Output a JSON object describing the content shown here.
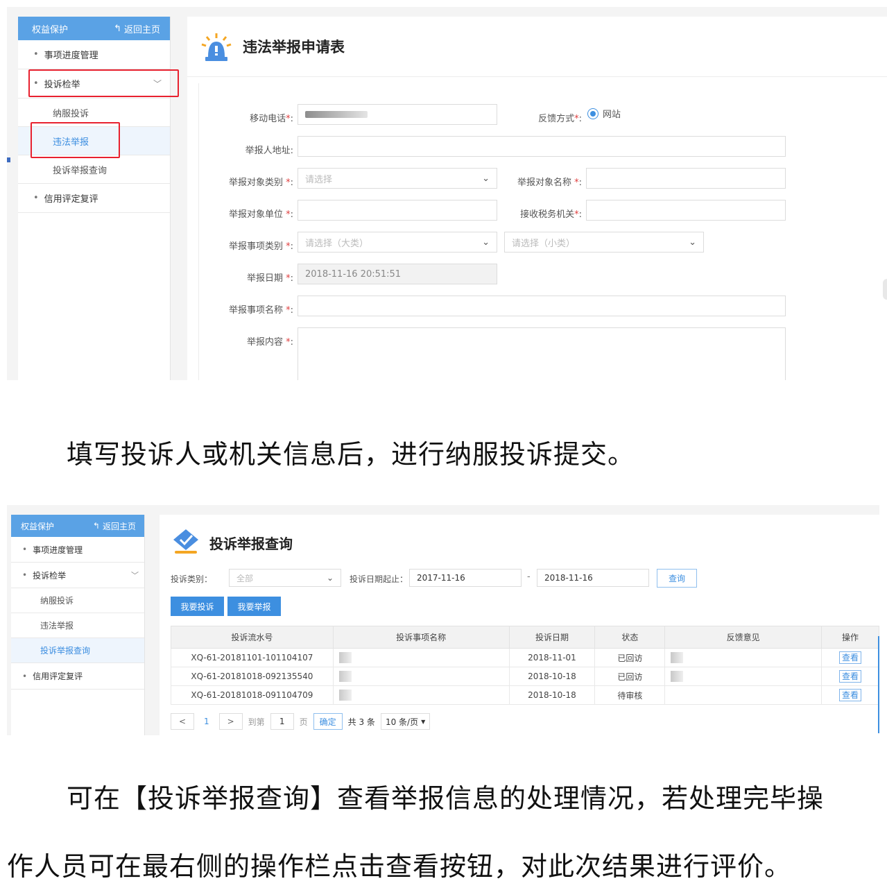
{
  "shot1": {
    "sidebar": {
      "header": "权益保护",
      "back_label": "返回主页",
      "items": [
        {
          "label": "事项进度管理"
        },
        {
          "label": "投诉检举"
        },
        {
          "label": "信用评定复评"
        }
      ],
      "subitems": [
        {
          "label": "纳服投诉"
        },
        {
          "label": "违法举报"
        },
        {
          "label": "投诉举报查询"
        }
      ]
    },
    "title": "违法举报申请表",
    "form": {
      "mobile_label": "移动电话",
      "feedback_label": "反馈方式",
      "feedback_option": "网站",
      "address_label": "举报人地址:",
      "target_type_label": "举报对象类别",
      "target_type_placeholder": "请选择",
      "target_name_label": "举报对象名称",
      "target_unit_label": "举报对象单位",
      "tax_office_label": "接收税务机关",
      "matter_type_label": "举报事项类别",
      "matter_big_placeholder": "请选择（大类）",
      "matter_small_placeholder": "请选择（小类）",
      "date_label": "举报日期",
      "date_value": "2018-11-16 20:51:51",
      "matter_name_label": "举报事项名称",
      "content_label": "举报内容",
      "req_mark": "*",
      "colon": ":"
    }
  },
  "para1": "填写投诉人或机关信息后，进行纳服投诉提交。",
  "shot2": {
    "sidebar": {
      "header": "权益保护",
      "back_label": "返回主页",
      "items": [
        {
          "label": "事项进度管理"
        },
        {
          "label": "投诉检举"
        },
        {
          "label": "信用评定复评"
        }
      ],
      "subitems": [
        {
          "label": "纳服投诉"
        },
        {
          "label": "违法举报"
        },
        {
          "label": "投诉举报查询"
        }
      ]
    },
    "title": "投诉举报查询",
    "filters": {
      "type_label": "投诉类别：",
      "type_value": "全部",
      "date_label": "投诉日期起止：",
      "date_from": "2017-11-16",
      "separator": "-",
      "date_to": "2018-11-16",
      "query_button": "查询"
    },
    "actions": {
      "complain_button": "我要投诉",
      "report_button": "我要举报"
    },
    "table": {
      "headers": [
        "投诉流水号",
        "投诉事项名称",
        "投诉日期",
        "状态",
        "反馈意见",
        "操作"
      ],
      "rows": [
        {
          "serial": "XQ-61-20181101-101104107",
          "date": "2018-11-01",
          "status": "已回访",
          "action": "查看"
        },
        {
          "serial": "XQ-61-20181018-092135540",
          "date": "2018-10-18",
          "status": "已回访",
          "action": "查看"
        },
        {
          "serial": "XQ-61-20181018-091104709",
          "date": "2018-10-18",
          "status": "待审核",
          "action": "查看"
        }
      ]
    },
    "pagination": {
      "prev": "<",
      "page": "1",
      "next": ">",
      "goto_label": "到第",
      "goto_value": "1",
      "page_unit": "页",
      "confirm": "确定",
      "total": "共 3 条",
      "page_size": "10 条/页"
    }
  },
  "para2_line1": "可在【投诉举报查询】查看举报信息的处理情况，若处理完毕操",
  "para2_line2": "作人员可在最右侧的操作栏点击查看按钮，对此次结果进行评价。",
  "colors": {
    "accent": "#3d8fe0",
    "highlight": "#e8212f",
    "sidebar_header": "#5aa2e5"
  }
}
